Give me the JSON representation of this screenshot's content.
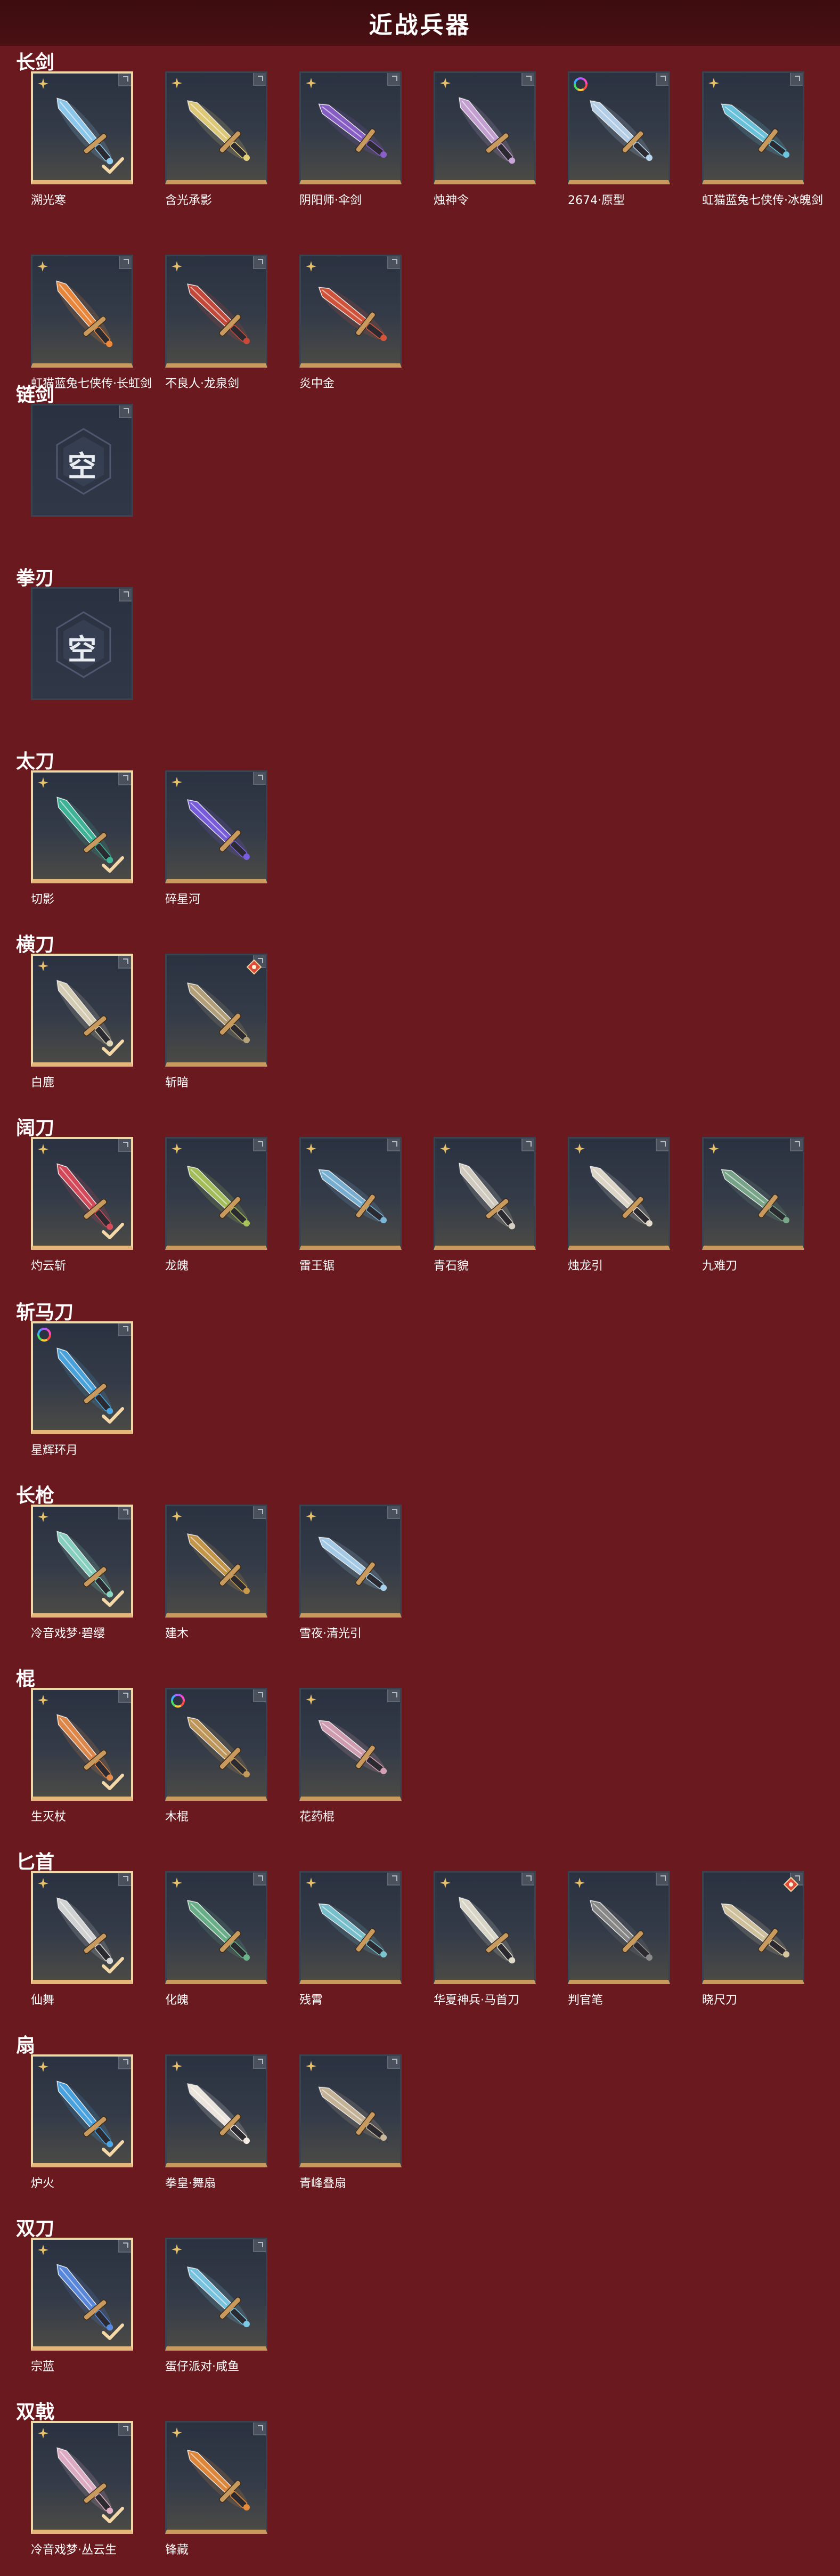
{
  "header": {
    "title": "近战兵器"
  },
  "empty_slot_text": "空",
  "colors": {
    "background": "#6a1a1e",
    "header": "#3c0c0f",
    "slot_border_bottom": "#c89a5e",
    "selected_border": "#f1d6a6",
    "star": "#e6c06b"
  },
  "categories": [
    {
      "title": "长剑",
      "items": [
        {
          "name": "溯光寒",
          "selected": true,
          "marker": "star",
          "color": "#8ecdf2"
        },
        {
          "name": "含光承影",
          "selected": false,
          "marker": "star",
          "color": "#e4cf7a"
        },
        {
          "name": "阴阳师·伞剑",
          "selected": false,
          "marker": "star",
          "color": "#8a5fc9"
        },
        {
          "name": "烛神令",
          "selected": false,
          "marker": "star",
          "color": "#c9a4d6"
        },
        {
          "name": "2674·原型",
          "selected": false,
          "marker": "ring",
          "color": "#b8d4ec"
        },
        {
          "name": "虹猫蓝兔七侠传·冰魄剑",
          "selected": false,
          "marker": "star",
          "color": "#6cc6e0"
        },
        {
          "name": "虹猫蓝兔七侠传·长虹剑",
          "selected": false,
          "marker": "star",
          "color": "#ef8a3a"
        },
        {
          "name": "不良人·龙泉剑",
          "selected": false,
          "marker": "star",
          "color": "#c94a3a"
        },
        {
          "name": "炎中金",
          "selected": false,
          "marker": "star",
          "color": "#d6553a"
        }
      ]
    },
    {
      "title": "链剑",
      "items": [
        {
          "name": "",
          "empty": true
        }
      ]
    },
    {
      "title": "拳刃",
      "items": [
        {
          "name": "",
          "empty": true
        }
      ]
    },
    {
      "title": "太刀",
      "items": [
        {
          "name": "切影",
          "selected": true,
          "marker": "star",
          "color": "#3fb89a"
        },
        {
          "name": "碎星河",
          "selected": false,
          "marker": "star",
          "color": "#7a5ee0"
        }
      ]
    },
    {
      "title": "横刀",
      "items": [
        {
          "name": "白鹿",
          "selected": true,
          "marker": "star",
          "color": "#dcd2b8"
        },
        {
          "name": "斩暗",
          "selected": false,
          "marker": "badge",
          "color": "#b8a47a"
        }
      ]
    },
    {
      "title": "阔刀",
      "items": [
        {
          "name": "灼云斩",
          "selected": true,
          "marker": "star",
          "color": "#d94a5a"
        },
        {
          "name": "龙魄",
          "selected": false,
          "marker": "star",
          "color": "#a8c25a"
        },
        {
          "name": "雷王锯",
          "selected": false,
          "marker": "star",
          "color": "#7ab4d6"
        },
        {
          "name": "青石貌",
          "selected": false,
          "marker": "star",
          "color": "#d6d0c4"
        },
        {
          "name": "烛龙引",
          "selected": false,
          "marker": "star",
          "color": "#e4dccc"
        },
        {
          "name": "九难刀",
          "selected": false,
          "marker": "star",
          "color": "#7aa88a"
        }
      ]
    },
    {
      "title": "斩马刀",
      "items": [
        {
          "name": "星辉环月",
          "selected": true,
          "marker": "ring",
          "color": "#4aa6e0"
        }
      ]
    },
    {
      "title": "长枪",
      "items": [
        {
          "name": "冷音戏梦·碧缨",
          "selected": true,
          "marker": "star",
          "color": "#8ad6c4"
        },
        {
          "name": "建木",
          "selected": false,
          "marker": "star",
          "color": "#c99a4a"
        },
        {
          "name": "雪夜·清光引",
          "selected": false,
          "marker": "star",
          "color": "#a8d0ec"
        }
      ]
    },
    {
      "title": "棍",
      "items": [
        {
          "name": "生灭杖",
          "selected": true,
          "marker": "star",
          "color": "#e48a4a"
        },
        {
          "name": "木棍",
          "selected": false,
          "marker": "ring",
          "color": "#c49a5a"
        },
        {
          "name": "花药棍",
          "selected": false,
          "marker": "star",
          "color": "#d6a0b4"
        }
      ]
    },
    {
      "title": "匕首",
      "items": [
        {
          "name": "仙舞",
          "selected": true,
          "marker": "star",
          "color": "#d8d8d8"
        },
        {
          "name": "化魄",
          "selected": false,
          "marker": "star",
          "color": "#6ab48a"
        },
        {
          "name": "残霄",
          "selected": false,
          "marker": "star",
          "color": "#7ac4d0"
        },
        {
          "name": "华夏神兵·马首刀",
          "selected": false,
          "marker": "star",
          "color": "#e0dccc"
        },
        {
          "name": "判官笔",
          "selected": false,
          "marker": "star",
          "color": "#8a8a8a"
        },
        {
          "name": "晓尺刀",
          "selected": false,
          "marker": "badge",
          "color": "#d6c6a0"
        }
      ]
    },
    {
      "title": "扇",
      "items": [
        {
          "name": "炉火",
          "selected": true,
          "marker": "star",
          "color": "#4aa6e4"
        },
        {
          "name": "拳皇·舞扇",
          "selected": false,
          "marker": "star",
          "color": "#f4ece4"
        },
        {
          "name": "青峰叠扇",
          "selected": false,
          "marker": "star",
          "color": "#cbb89a"
        }
      ]
    },
    {
      "title": "双刀",
      "items": [
        {
          "name": "宗蓝",
          "selected": true,
          "marker": "star",
          "color": "#5a8ae0"
        },
        {
          "name": "蛋仔派对·咸鱼",
          "selected": false,
          "marker": "star",
          "color": "#7ac8e4"
        }
      ]
    },
    {
      "title": "双戟",
      "items": [
        {
          "name": "冷音戏梦·丛云生",
          "selected": true,
          "marker": "star",
          "color": "#e4b0c8"
        },
        {
          "name": "锋藏",
          "selected": false,
          "marker": "star",
          "color": "#e48a3a"
        }
      ]
    }
  ]
}
